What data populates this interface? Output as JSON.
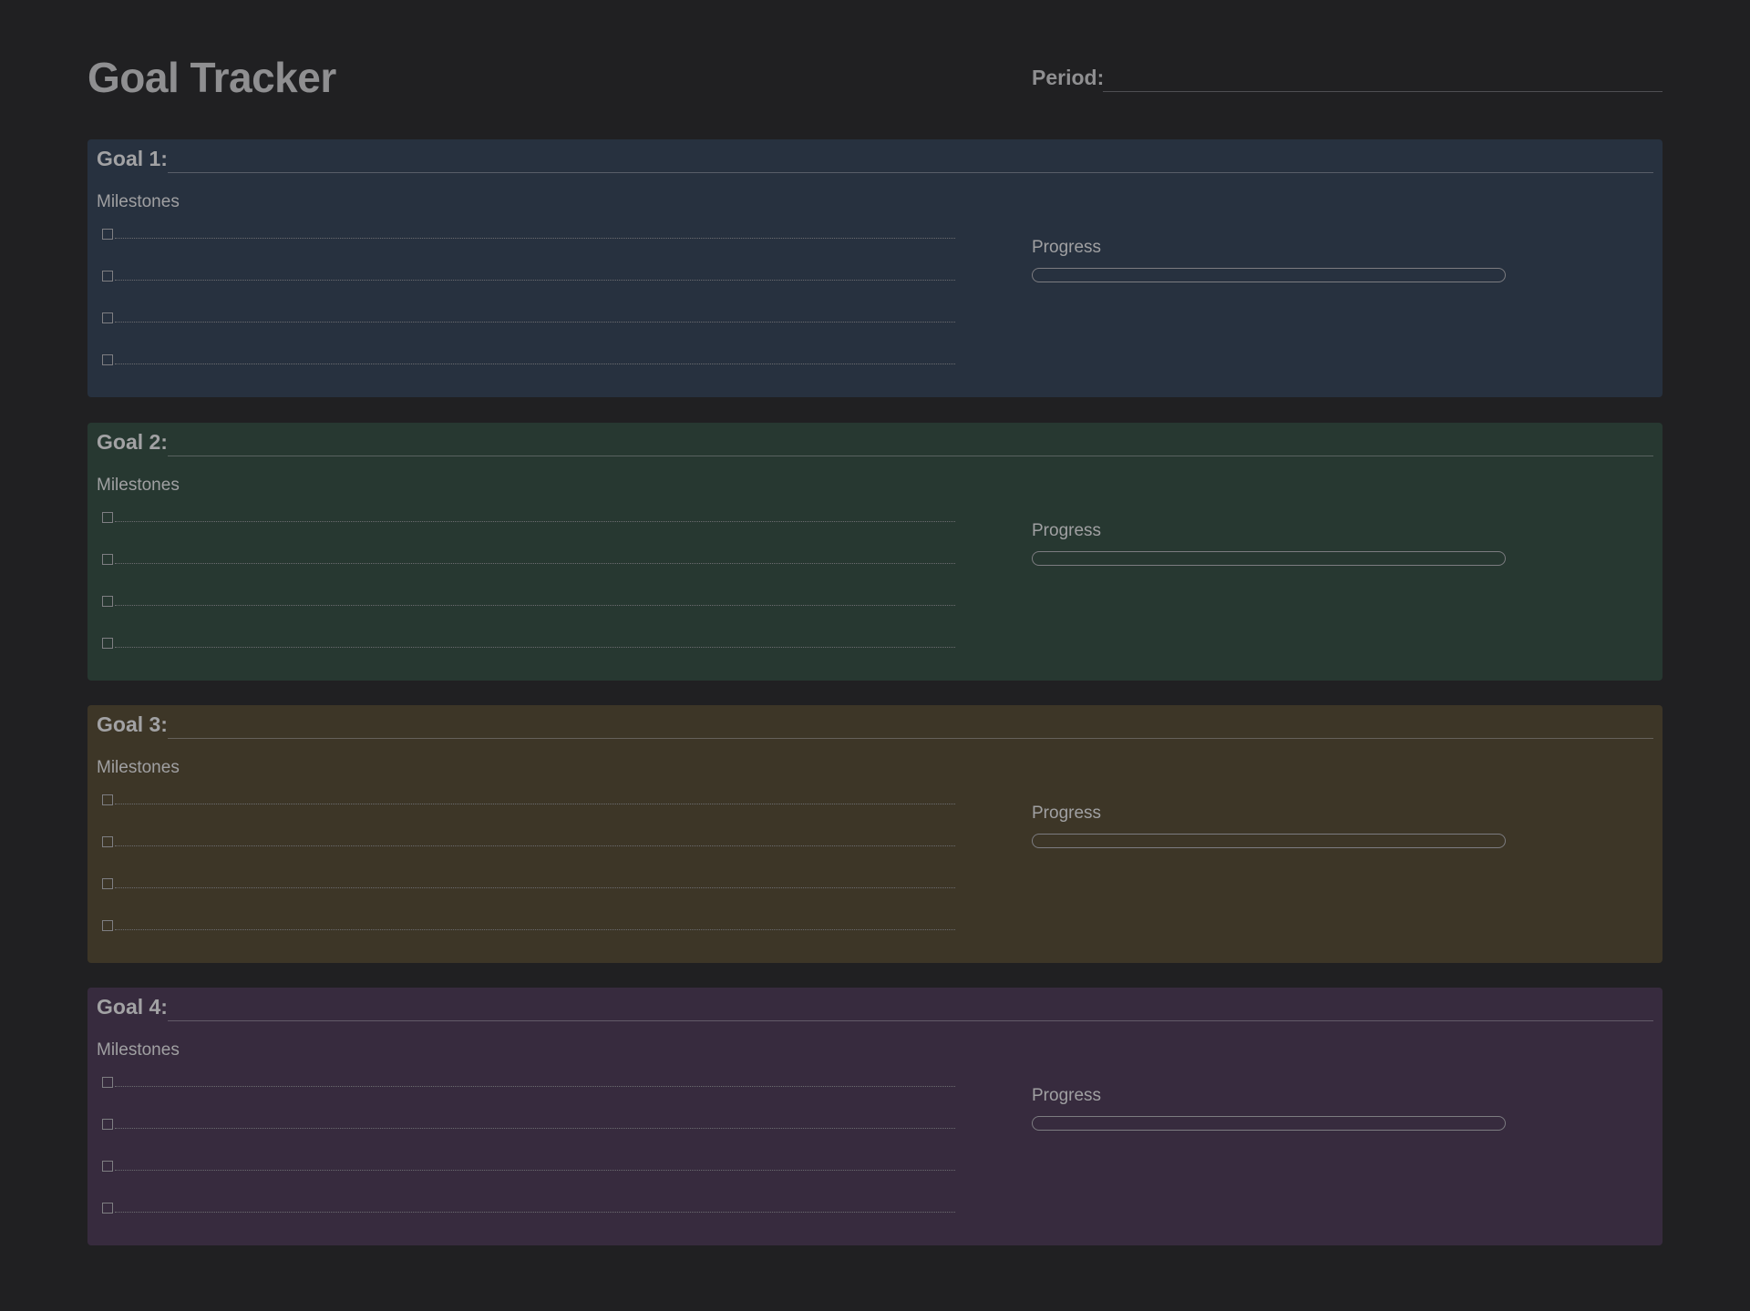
{
  "header": {
    "title": "Goal Tracker",
    "period_label": "Period:",
    "period_value": ""
  },
  "colors": {
    "background": "#202022",
    "goal_1_bg": "#27313f",
    "goal_2_bg": "#273831",
    "goal_3_bg": "#3d3627",
    "goal_4_bg": "#372b3e"
  },
  "goals": [
    {
      "label": "Goal 1:",
      "value": "",
      "milestones_label": "Milestones",
      "milestones": [
        "",
        "",
        "",
        ""
      ],
      "progress_label": "Progress",
      "progress": 0
    },
    {
      "label": "Goal 2:",
      "value": "",
      "milestones_label": "Milestones",
      "milestones": [
        "",
        "",
        "",
        ""
      ],
      "progress_label": "Progress",
      "progress": 0
    },
    {
      "label": "Goal 3:",
      "value": "",
      "milestones_label": "Milestones",
      "milestones": [
        "",
        "",
        "",
        ""
      ],
      "progress_label": "Progress",
      "progress": 0
    },
    {
      "label": "Goal 4:",
      "value": "",
      "milestones_label": "Milestones",
      "milestones": [
        "",
        "",
        "",
        ""
      ],
      "progress_label": "Progress",
      "progress": 0
    }
  ]
}
